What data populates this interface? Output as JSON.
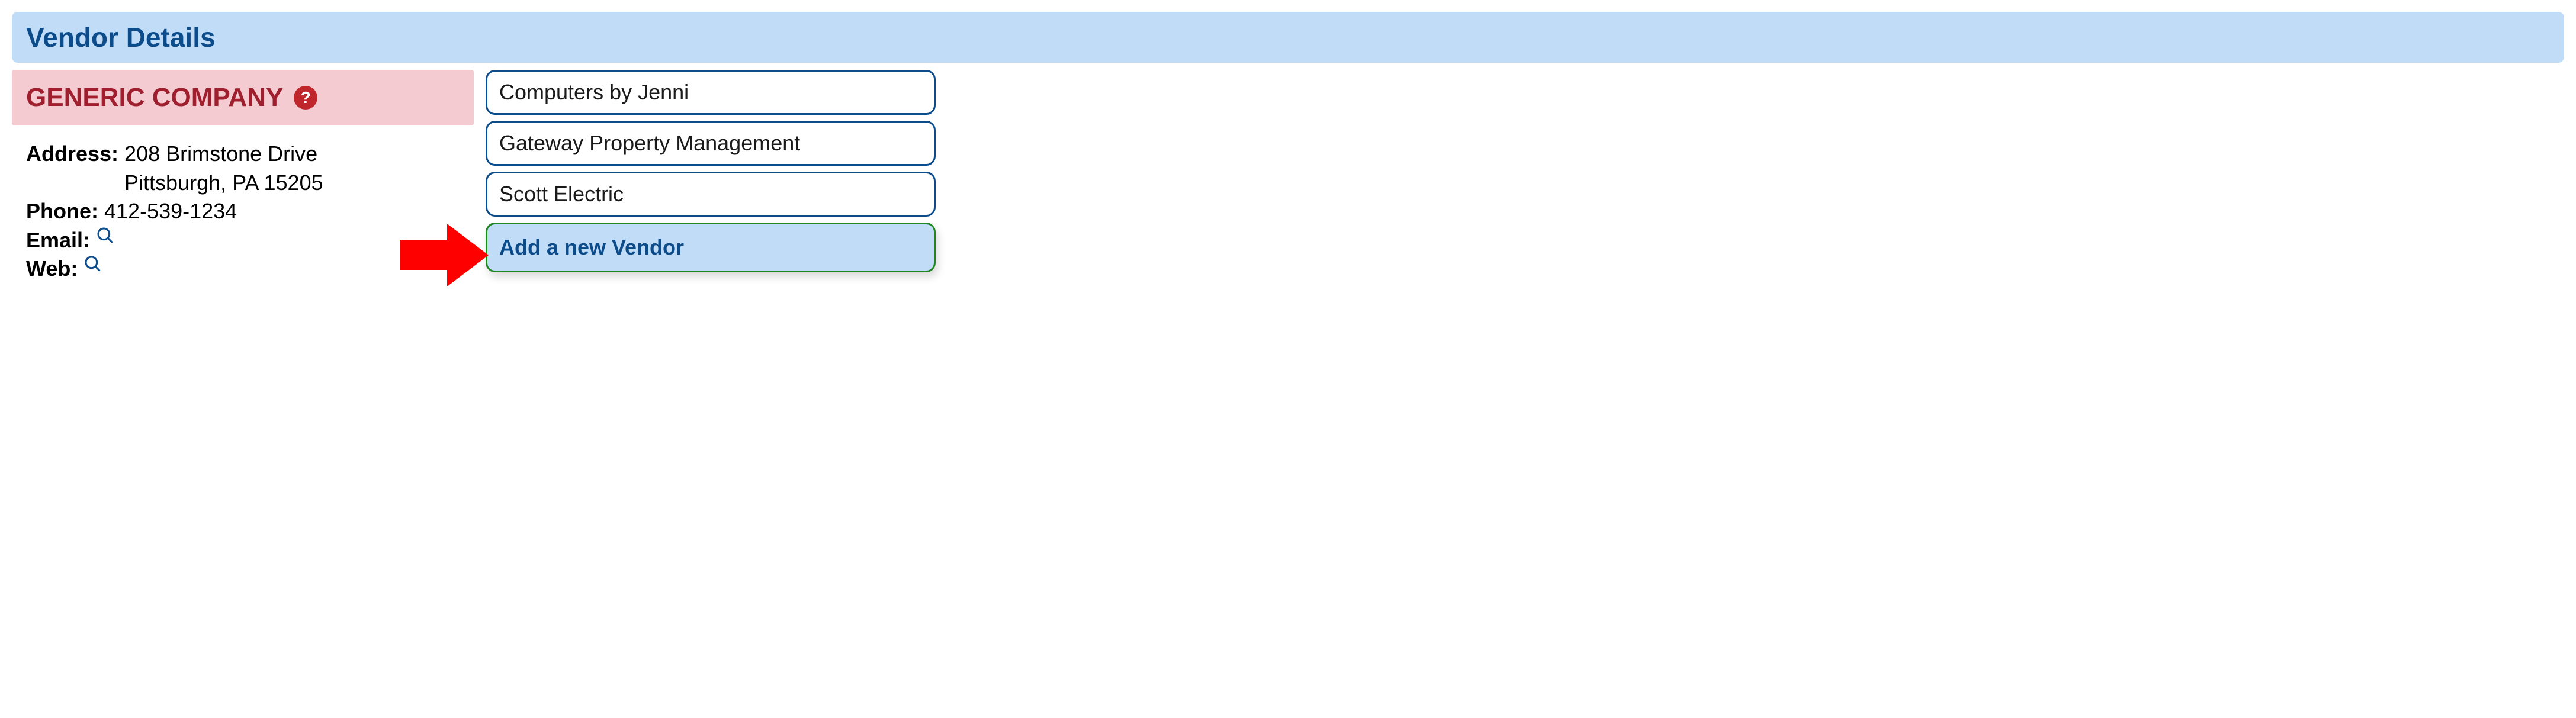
{
  "header": {
    "title": "Vendor Details"
  },
  "company": {
    "name": "GENERIC COMPANY",
    "help_tooltip": "?"
  },
  "details": {
    "address_label": "Address:",
    "address_line1": "208 Brimstone Drive",
    "address_line2": "Pittsburgh, PA 15205",
    "phone_label": "Phone:",
    "phone_value": "412-539-1234",
    "email_label": "Email:",
    "web_label": "Web:"
  },
  "vendors": {
    "items": [
      {
        "label": "Computers by Jenni"
      },
      {
        "label": "Gateway Property Management"
      },
      {
        "label": "Scott Electric"
      }
    ],
    "add_label": "Add a new Vendor"
  },
  "colors": {
    "accent_blue": "#0d4c8b",
    "light_blue": "#c0dcf7",
    "banner_pink": "#f3cbd0",
    "company_red": "#a01f2e",
    "help_red": "#c0272d",
    "add_border_green": "#228722",
    "arrow_red": "#ff0000"
  }
}
